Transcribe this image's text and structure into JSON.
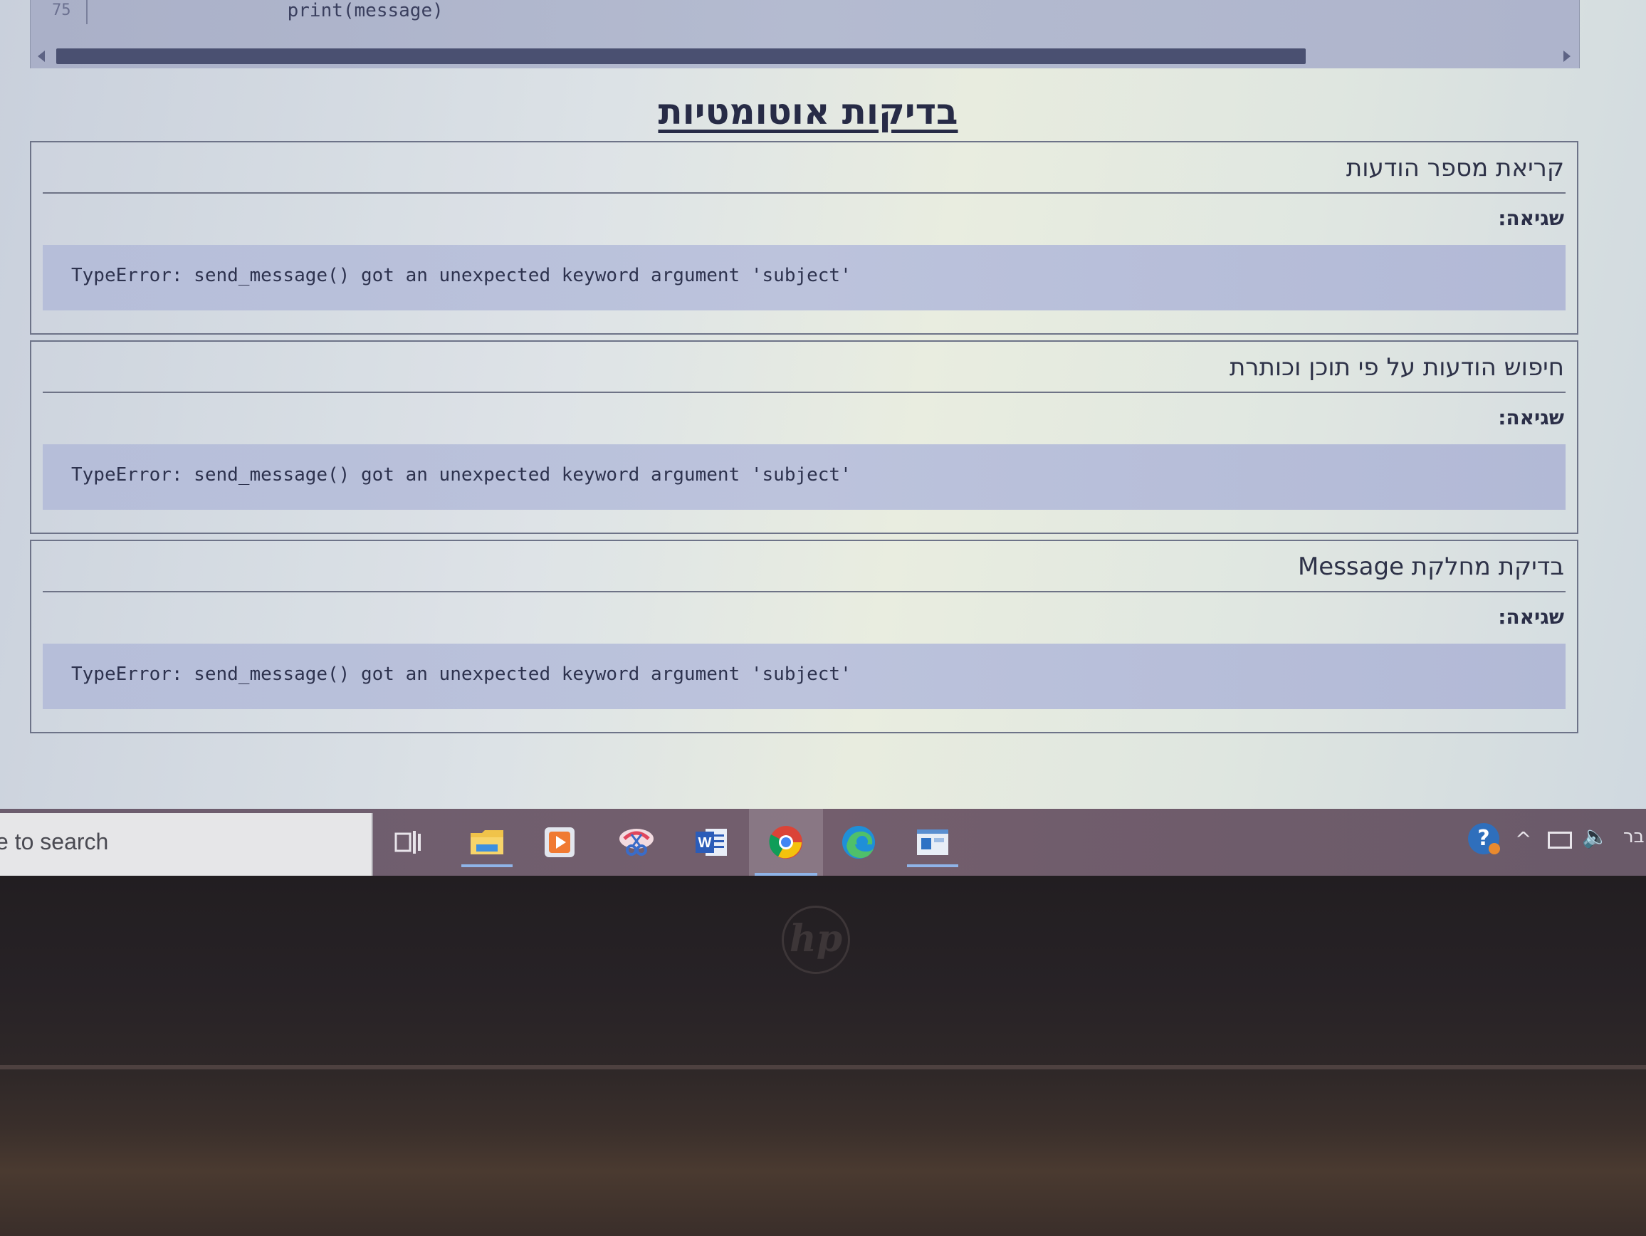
{
  "code_view": {
    "line_number": "75",
    "code_line": "    print(message)"
  },
  "page": {
    "title": "בדיקות אוטומטיות"
  },
  "tests": [
    {
      "title": "קריאת מספר הודעות",
      "error_label": "שגיאה:",
      "error_text": "TypeError: send_message() got an unexpected keyword argument 'subject'"
    },
    {
      "title": "חיפוש הודעות על פי תוכן וכותרת",
      "error_label": "שגיאה:",
      "error_text": "TypeError: send_message() got an unexpected keyword argument 'subject'"
    },
    {
      "title": "בדיקת מחלקת Message",
      "error_label": "שגיאה:",
      "error_text": "TypeError: send_message() got an unexpected keyword argument 'subject'"
    }
  ],
  "taskbar": {
    "search_text": "e to search",
    "apps": [
      {
        "icon": "task-view-icon"
      },
      {
        "icon": "file-explorer-icon"
      },
      {
        "icon": "media-player-icon"
      },
      {
        "icon": "snipping-tool-icon"
      },
      {
        "icon": "word-icon"
      },
      {
        "icon": "chrome-icon"
      },
      {
        "icon": "edge-icon"
      },
      {
        "icon": "window-app-icon"
      }
    ],
    "tray": {
      "help_glyph": "?",
      "chevron_glyph": "^",
      "volume_glyph": "🔈",
      "language": "בר"
    }
  },
  "bezel": {
    "logo_text": "hp"
  }
}
